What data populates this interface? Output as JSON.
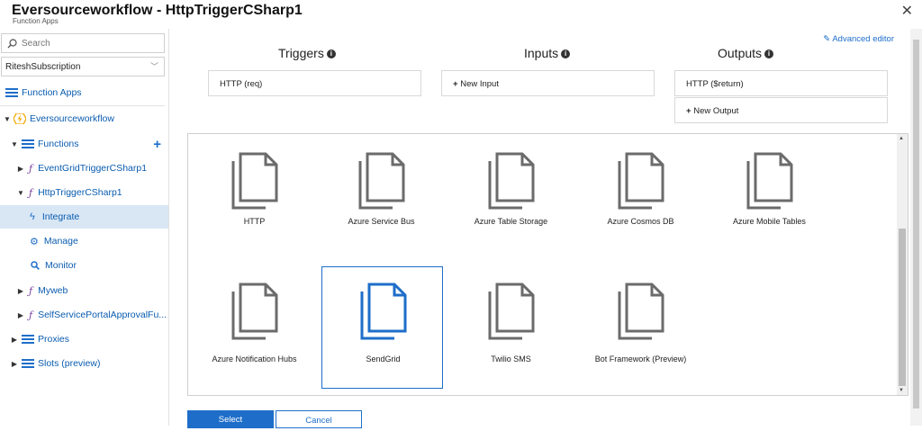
{
  "header": {
    "title": "Eversourceworkflow - HttpTriggerCSharp1",
    "subtitle": "Function Apps",
    "close_glyph": "✕"
  },
  "sidebar": {
    "search_placeholder": "Search",
    "subscription": "RiteshSubscription",
    "function_apps": "Function Apps",
    "app_name": "Eversourceworkflow",
    "functions": "Functions",
    "items": [
      {
        "label": "EventGridTriggerCSharp1"
      },
      {
        "label": "HttpTriggerCSharp1"
      },
      {
        "label": "Integrate"
      },
      {
        "label": "Manage"
      },
      {
        "label": "Monitor"
      },
      {
        "label": "Myweb"
      },
      {
        "label": "SelfServicePortalApprovalFu..."
      },
      {
        "label": "Proxies"
      },
      {
        "label": "Slots (preview)"
      }
    ]
  },
  "main": {
    "advanced_editor": "Advanced editor",
    "triggers_title": "Triggers",
    "inputs_title": "Inputs",
    "outputs_title": "Outputs",
    "trigger_box": "HTTP (req)",
    "new_input": "New Input",
    "output_box": "HTTP ($return)",
    "new_output": "New Output",
    "tiles": [
      {
        "label": "HTTP"
      },
      {
        "label": "Azure Service Bus"
      },
      {
        "label": "Azure Table Storage"
      },
      {
        "label": "Azure Cosmos DB"
      },
      {
        "label": "Azure Mobile Tables"
      },
      {
        "label": "Azure Notification Hubs"
      },
      {
        "label": "SendGrid"
      },
      {
        "label": "Twilio SMS"
      },
      {
        "label": "Bot Framework (Preview)"
      }
    ],
    "selected_tile": "SendGrid",
    "select_button": "Select",
    "cancel_button": "Cancel"
  },
  "colors": {
    "accent": "#1e6ec9",
    "selected_background": "#d9e7f5",
    "icon_gray": "#6b6b6b"
  }
}
